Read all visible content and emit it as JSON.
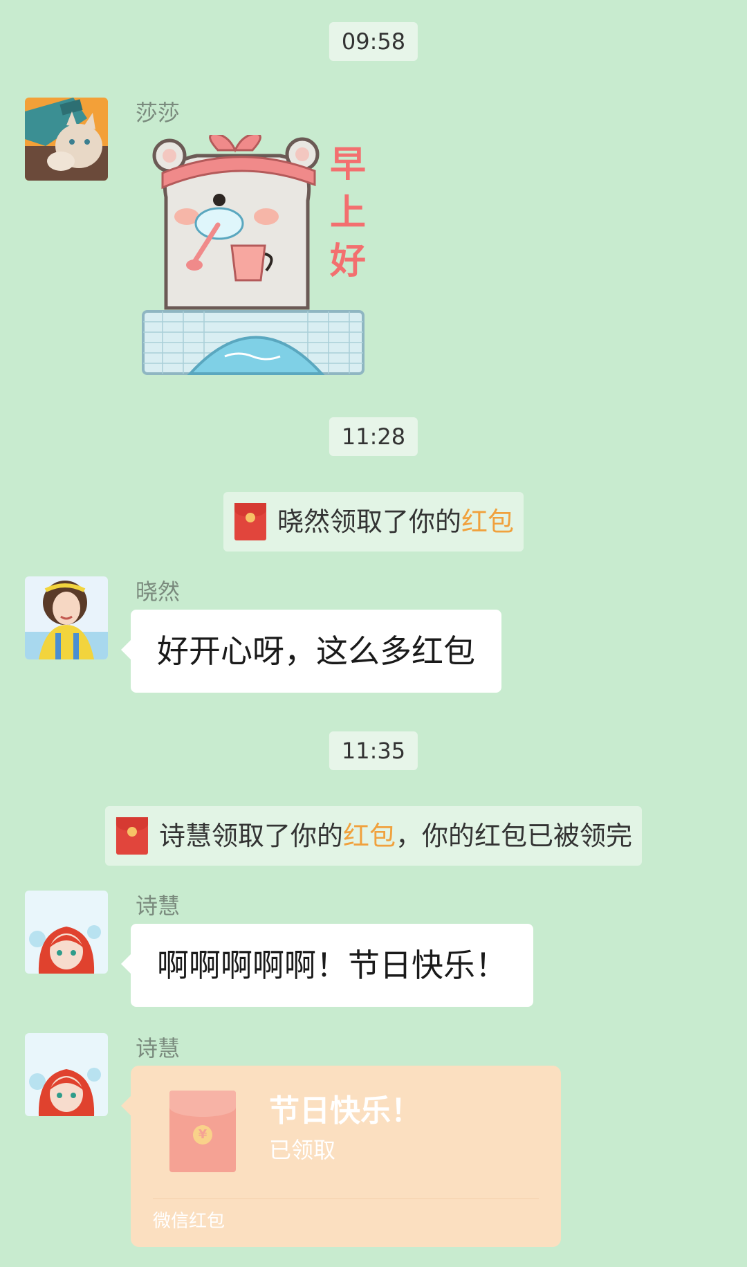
{
  "timestamps": [
    "09:58",
    "11:28",
    "11:35"
  ],
  "messages": {
    "m1": {
      "sender": "莎莎",
      "sticker_text": [
        "早",
        "上",
        "好"
      ]
    },
    "sys1": {
      "pre": "晓然领取了你的",
      "link": "红包",
      "post": ""
    },
    "m2": {
      "sender": "晓然",
      "text": "好开心呀，这么多红包"
    },
    "sys2": {
      "pre": "诗慧领取了你的",
      "link": "红包",
      "post": "，你的红包已被领完"
    },
    "m3": {
      "sender": "诗慧",
      "text": "啊啊啊啊啊！节日快乐！"
    },
    "m4": {
      "sender": "诗慧",
      "redpacket": {
        "title": "节日快乐！",
        "status": "已领取",
        "footer": "微信红包"
      }
    }
  },
  "colors": {
    "chat_background": "#c8ebcf",
    "bubble": "#ffffff",
    "redpacket_opened": "#fbdfc0",
    "link_highlight": "#f0a13d"
  }
}
